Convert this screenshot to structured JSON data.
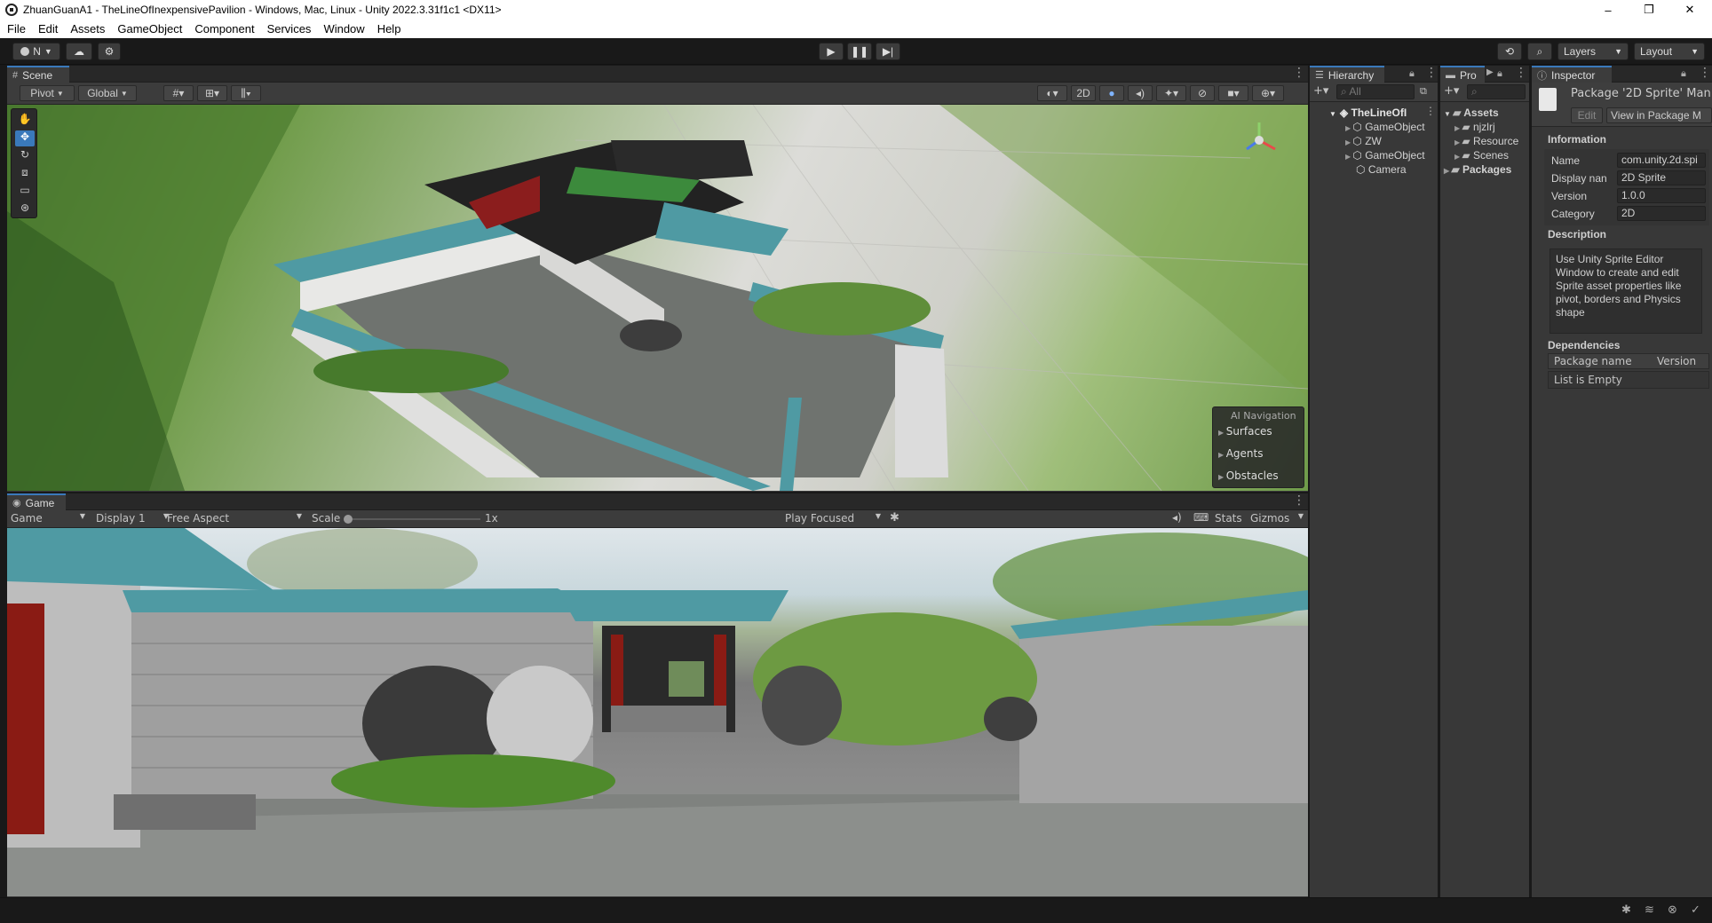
{
  "window": {
    "title": "ZhuanGuanA1 - TheLineOfInexpensivePavilion - Windows, Mac, Linux - Unity 2022.3.31f1c1 <DX11>",
    "controls": [
      "–",
      "❐",
      "✕"
    ]
  },
  "menu": [
    "File",
    "Edit",
    "Assets",
    "GameObject",
    "Component",
    "Services",
    "Window",
    "Help"
  ],
  "toolbar": {
    "account_label": "N",
    "layers_label": "Layers",
    "layout_label": "Layout"
  },
  "scene": {
    "tab_label": "Scene",
    "pivot_label": "Pivot",
    "global_label": "Global",
    "mode_2d": "2D",
    "ai_nav": {
      "title": "AI Navigation",
      "items": [
        "Surfaces",
        "Agents",
        "Obstacles"
      ]
    }
  },
  "game": {
    "tab_label": "Game",
    "mode": "Game",
    "display": "Display 1",
    "aspect": "Free Aspect",
    "scale_label": "Scale",
    "scale_value": "1x",
    "play_focused": "Play Focused",
    "stats_label": "Stats",
    "gizmos_label": "Gizmos"
  },
  "hierarchy": {
    "tab_label": "Hierarchy",
    "search_placeholder": "All",
    "scene_name": "TheLineOfI",
    "items": [
      "GameObject",
      "ZW",
      "GameObject",
      "Camera"
    ]
  },
  "project": {
    "tab_label": "Pro",
    "items": [
      "Assets",
      "njzlrj",
      "Resource",
      "Scenes",
      "Packages"
    ]
  },
  "inspector": {
    "tab_label": "Inspector",
    "header_title": "Package '2D Sprite' Man",
    "edit_label": "Edit",
    "view_label": "View in Package M",
    "information_title": "Information",
    "rows": [
      {
        "label": "Name",
        "value": "com.unity.2d.spi"
      },
      {
        "label": "Display nan",
        "value": "2D Sprite"
      },
      {
        "label": "Version",
        "value": "1.0.0"
      },
      {
        "label": "Category",
        "value": "2D"
      }
    ],
    "description_title": "Description",
    "description": "Use Unity Sprite Editor Window to create and edit Sprite asset properties like pivot, borders and Physics shape",
    "dependencies_title": "Dependencies",
    "dep_col_name": "Package name",
    "dep_col_version": "Version",
    "dep_empty": "List is Empty"
  },
  "colors": {
    "accent": "#3a79bb",
    "panel_bg": "#383838",
    "toolbar_bg": "#191919",
    "roof_teal": "#4f9aa3",
    "grass": "#5f8e3a"
  }
}
